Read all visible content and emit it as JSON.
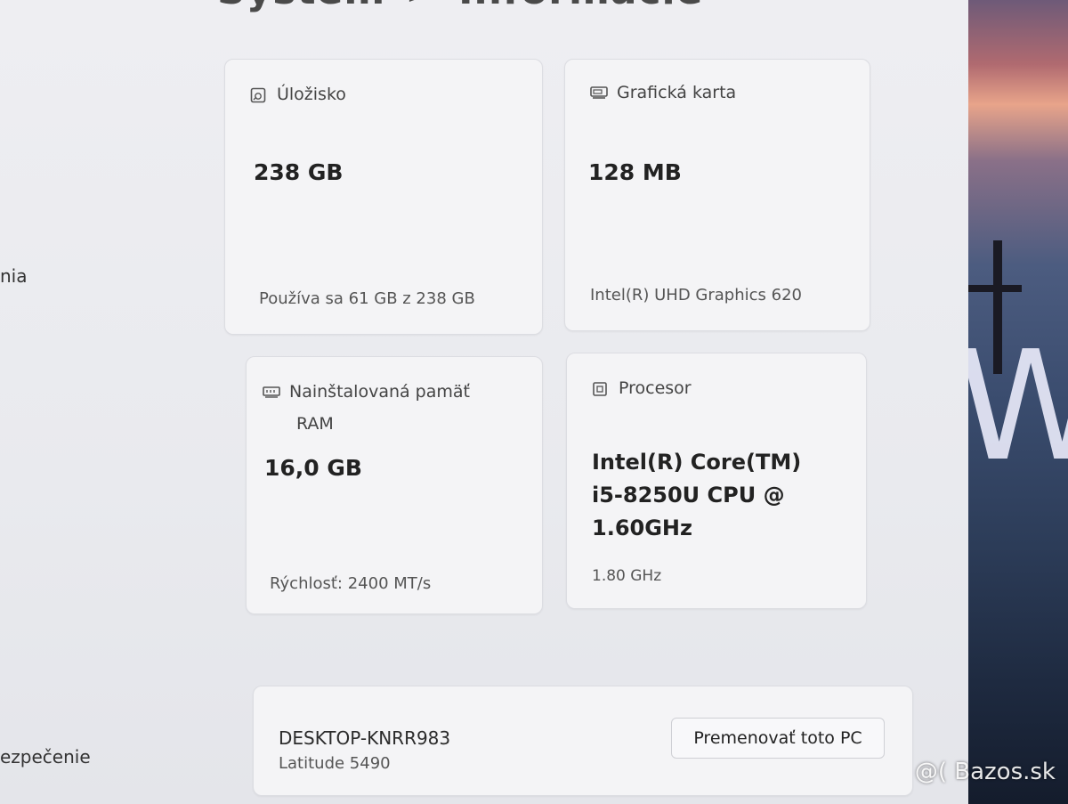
{
  "header": {
    "breadcrumb_root": "Systém",
    "breadcrumb_separator": ">",
    "page_title": "Informácie"
  },
  "sidebar": {
    "items": [
      {
        "label": "nia"
      },
      {
        "label": "ezpečenie"
      }
    ]
  },
  "specs": {
    "storage": {
      "title": "Úložisko",
      "value": "238 GB",
      "detail": "Používa sa 61 GB z 238 GB"
    },
    "graphics": {
      "title": "Grafická karta",
      "value": "128 MB",
      "detail": "Intel(R) UHD Graphics 620"
    },
    "ram": {
      "title_line1": "Nainštalovaná pamäť",
      "title_line2": "RAM",
      "value": "16,0 GB",
      "detail": "Rýchlosť: 2400 MT/s"
    },
    "processor": {
      "title": "Procesor",
      "value_line1": "Intel(R) Core(TM)",
      "value_line2": "i5-8250U CPU @",
      "value_line3": "1.60GHz",
      "detail": "1.80 GHz"
    }
  },
  "device": {
    "name": "DESKTOP-KNRR983",
    "model": "Latitude 5490",
    "rename_label": "Premenovať toto PC"
  },
  "wallpaper": {
    "letter": "W"
  },
  "watermark": {
    "text": "@( Bazos.sk"
  },
  "icons": [
    "storage-icon",
    "graphics-card-icon",
    "memory-icon",
    "processor-icon"
  ],
  "colors": {
    "card_background": "#f4f4f6",
    "window_background": "#eeeef2"
  }
}
